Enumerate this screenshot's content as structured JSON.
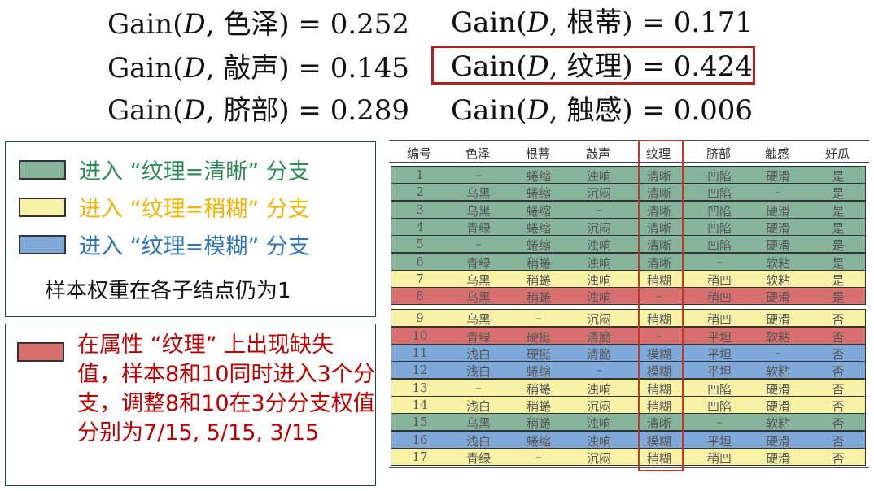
{
  "formulas": [
    {
      "prefix": "Gain(",
      "var": "D",
      "attr": ", 色泽) = 0.252"
    },
    {
      "prefix": "Gain(",
      "var": "D",
      "attr": ", 敲声) = 0.145"
    },
    {
      "prefix": "Gain(",
      "var": "D",
      "attr": ", 脐部) = 0.289"
    },
    {
      "prefix": "Gain(",
      "var": "D",
      "attr": ", 根蒂) = 0.171"
    },
    {
      "prefix": "Gain(",
      "var": "D",
      "attr": ", 纹理) = 0.424"
    },
    {
      "prefix": "Gain(",
      "var": "D",
      "attr": ", 触感) = 0.006"
    }
  ],
  "legend": {
    "items": [
      {
        "label": "进入 “纹理=清晰” 分支",
        "color": "#2e8b57",
        "swatch": "#86b59c"
      },
      {
        "label": "进入 “纹理=稍糊” 分支",
        "color": "#f0b400",
        "swatch": "#f7f2a6"
      },
      {
        "label": "进入 “纹理=模糊” 分支",
        "color": "#2e75b6",
        "swatch": "#7ea9d8"
      }
    ],
    "note": "样本权重在各子结点仍为1"
  },
  "missing": {
    "swatch": "#d97070",
    "text": "在属性 “纹理” 上出现缺失值，样本8和10同时进入3个分支，调整8和10在3分分支权值分别为7/15, 5/15, 3/15"
  },
  "table": {
    "headers": [
      "编号",
      "色泽",
      "根蒂",
      "敲声",
      "纹理",
      "脐部",
      "触感",
      "好瓜"
    ],
    "rows": [
      [
        "1",
        "–",
        "蜷缩",
        "浊响",
        "清晰",
        "凹陷",
        "硬滑",
        "是"
      ],
      [
        "2",
        "乌黑",
        "蜷缩",
        "沉闷",
        "清晰",
        "凹陷",
        "–",
        "是"
      ],
      [
        "3",
        "乌黑",
        "蜷缩",
        "–",
        "清晰",
        "凹陷",
        "硬滑",
        "是"
      ],
      [
        "4",
        "青绿",
        "蜷缩",
        "沉闷",
        "清晰",
        "凹陷",
        "硬滑",
        "是"
      ],
      [
        "5",
        "–",
        "蜷缩",
        "浊响",
        "清晰",
        "凹陷",
        "硬滑",
        "是"
      ],
      [
        "6",
        "青绿",
        "稍蜷",
        "浊响",
        "清晰",
        "–",
        "软粘",
        "是"
      ],
      [
        "7",
        "乌黑",
        "稍蜷",
        "浊响",
        "稍糊",
        "稍凹",
        "软粘",
        "是"
      ],
      [
        "8",
        "乌黑",
        "稍蜷",
        "浊响",
        "–",
        "稍凹",
        "硬滑",
        "是"
      ],
      [
        "9",
        "乌黑",
        "–",
        "沉闷",
        "稍糊",
        "稍凹",
        "硬滑",
        "否"
      ],
      [
        "10",
        "青绿",
        "硬挺",
        "清脆",
        "–",
        "平坦",
        "软粘",
        "否"
      ],
      [
        "11",
        "浅白",
        "硬挺",
        "清脆",
        "模糊",
        "平坦",
        "–",
        "否"
      ],
      [
        "12",
        "浅白",
        "蜷缩",
        "–",
        "模糊",
        "平坦",
        "软粘",
        "否"
      ],
      [
        "13",
        "–",
        "稍蜷",
        "浊响",
        "稍糊",
        "凹陷",
        "硬滑",
        "否"
      ],
      [
        "14",
        "浅白",
        "稍蜷",
        "沉闷",
        "稍糊",
        "凹陷",
        "硬滑",
        "否"
      ],
      [
        "15",
        "乌黑",
        "稍蜷",
        "浊响",
        "清晰",
        "–",
        "软粘",
        "否"
      ],
      [
        "16",
        "浅白",
        "蜷缩",
        "浊响",
        "模糊",
        "平坦",
        "硬滑",
        "否"
      ],
      [
        "17",
        "青绿",
        "–",
        "沉闷",
        "稍糊",
        "稍凹",
        "硬滑",
        "否"
      ]
    ],
    "row_colors": [
      "#86b59c",
      "#86b59c",
      "#86b59c",
      "#86b59c",
      "#86b59c",
      "#86b59c",
      "#f7f2a6",
      "#d97070",
      "#f7f2a6",
      "#d97070",
      "#7ea9d8",
      "#7ea9d8",
      "#f7f2a6",
      "#f7f2a6",
      "#86b59c",
      "#7ea9d8",
      "#f7f2a6"
    ]
  }
}
